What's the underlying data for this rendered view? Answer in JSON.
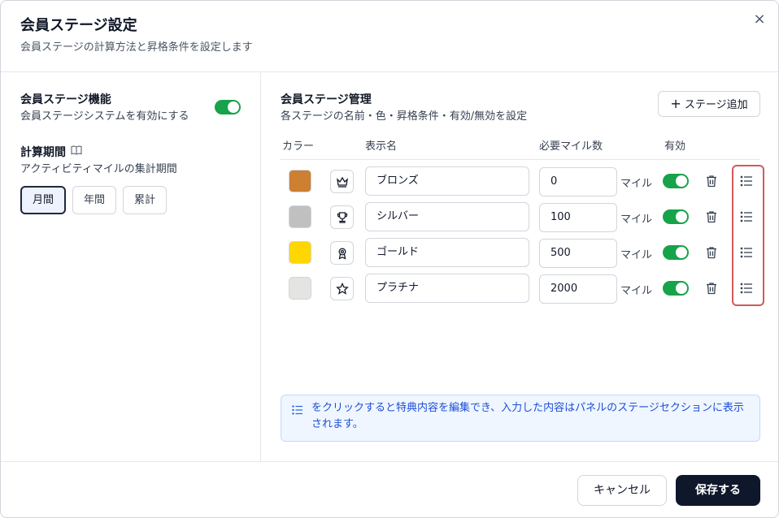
{
  "dialog": {
    "title": "会員ステージ設定",
    "subtitle": "会員ステージの計算方法と昇格条件を設定します",
    "close_label": "×"
  },
  "left": {
    "feature_title": "会員ステージ機能",
    "feature_desc": "会員ステージシステムを有効にする",
    "feature_enabled": true,
    "period_title": "計算期間",
    "period_desc": "アクティビティマイルの集計期間",
    "period_options": [
      "月間",
      "年間",
      "累計"
    ],
    "period_selected": "月間"
  },
  "right": {
    "title": "会員ステージ管理",
    "desc": "各ステージの名前・色・昇格条件・有効/無効を設定",
    "add_button": "ステージ追加",
    "columns": {
      "color": "カラー",
      "name": "表示名",
      "miles": "必要マイル数",
      "enabled": "有効"
    },
    "stages": [
      {
        "color": "#cd7f32",
        "icon": "crown-icon",
        "name": "ブロンズ",
        "miles": "0",
        "unit": "マイル",
        "enabled": true
      },
      {
        "color": "#c0c0c0",
        "icon": "trophy-icon",
        "name": "シルバー",
        "miles": "100",
        "unit": "マイル",
        "enabled": true
      },
      {
        "color": "#ffd700",
        "icon": "medal-icon",
        "name": "ゴールド",
        "miles": "500",
        "unit": "マイル",
        "enabled": true
      },
      {
        "color": "#e5e4e2",
        "icon": "star-icon",
        "name": "プラチナ",
        "miles": "2000",
        "unit": "マイル",
        "enabled": true
      }
    ],
    "info_text": "をクリックすると特典内容を編集でき、入力した内容はパネルのステージセクションに表示されます。"
  },
  "footer": {
    "cancel": "キャンセル",
    "save": "保存する"
  },
  "colors": {
    "accent": "#16a34a",
    "primary": "#0f172a",
    "info_bg": "#eff6ff",
    "info_text": "#1d4ed8",
    "highlight": "#d35a5a"
  }
}
